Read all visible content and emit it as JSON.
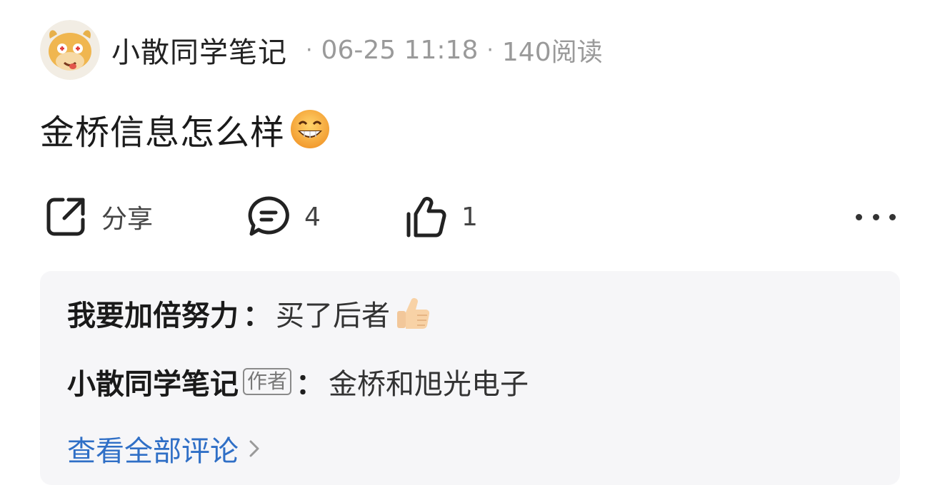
{
  "post": {
    "author": "小散同学笔记",
    "sep": "·",
    "datetime": "06-25 11:18",
    "reads": "140阅读",
    "title": "金桥信息怎么样",
    "title_emoji": "grinning-face-emoji"
  },
  "actions": {
    "share_label": "分享",
    "comment_count": "4",
    "like_count": "1",
    "icons": [
      "share-icon",
      "comment-icon",
      "thumbs-up-icon",
      "more-icon"
    ]
  },
  "comments": {
    "items": [
      {
        "user": "我要加倍努力",
        "colon": "：",
        "text": "买了后者",
        "emoji": "thumbs-up-emoji"
      },
      {
        "user": "小散同学笔记",
        "badge": "作者",
        "colon": "：",
        "text": "金桥和旭光电子"
      }
    ],
    "view_all": "查看全部评论"
  },
  "colors": {
    "link": "#2f6fc6",
    "meta": "#9a9a9a",
    "comment_bg": "#f6f6f8"
  }
}
